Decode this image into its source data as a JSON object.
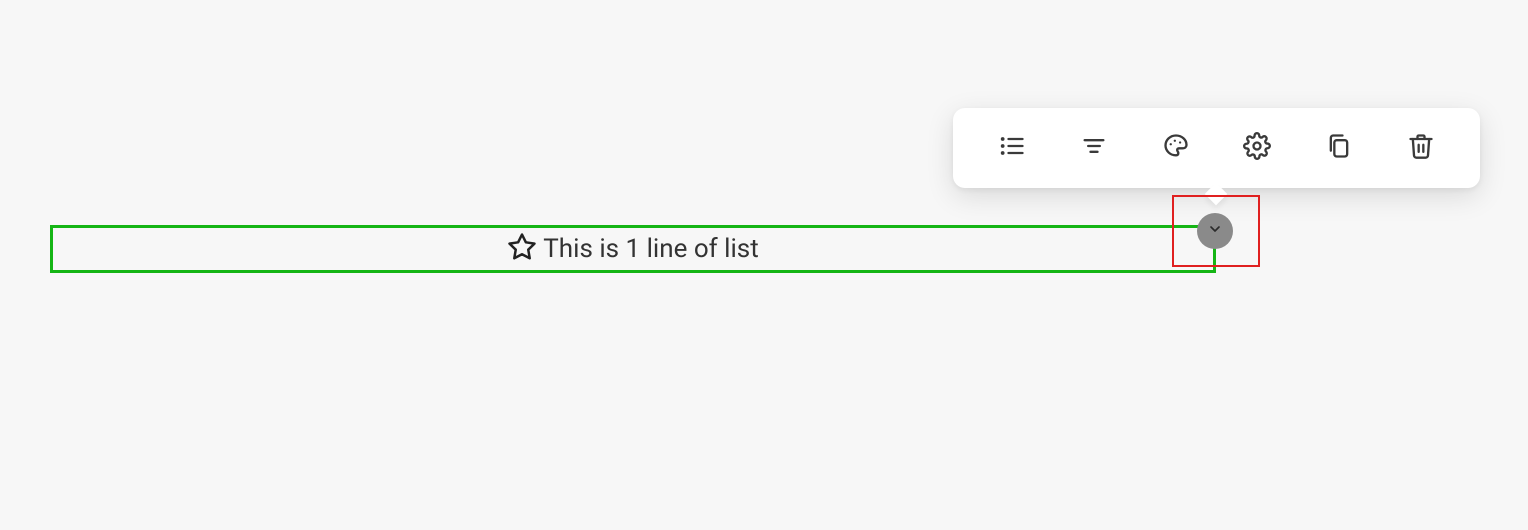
{
  "toolbar": {
    "items": [
      {
        "name": "list-icon"
      },
      {
        "name": "align-icon"
      },
      {
        "name": "palette-icon"
      },
      {
        "name": "settings-icon"
      },
      {
        "name": "copy-icon"
      },
      {
        "name": "trash-icon"
      }
    ]
  },
  "list": {
    "bullet_icon": "star-outline",
    "text": "This is 1 line of list"
  },
  "knob": {
    "icon": "chevron-down"
  },
  "highlight": {
    "color": "#e02020"
  },
  "selection": {
    "color": "#15b515"
  }
}
